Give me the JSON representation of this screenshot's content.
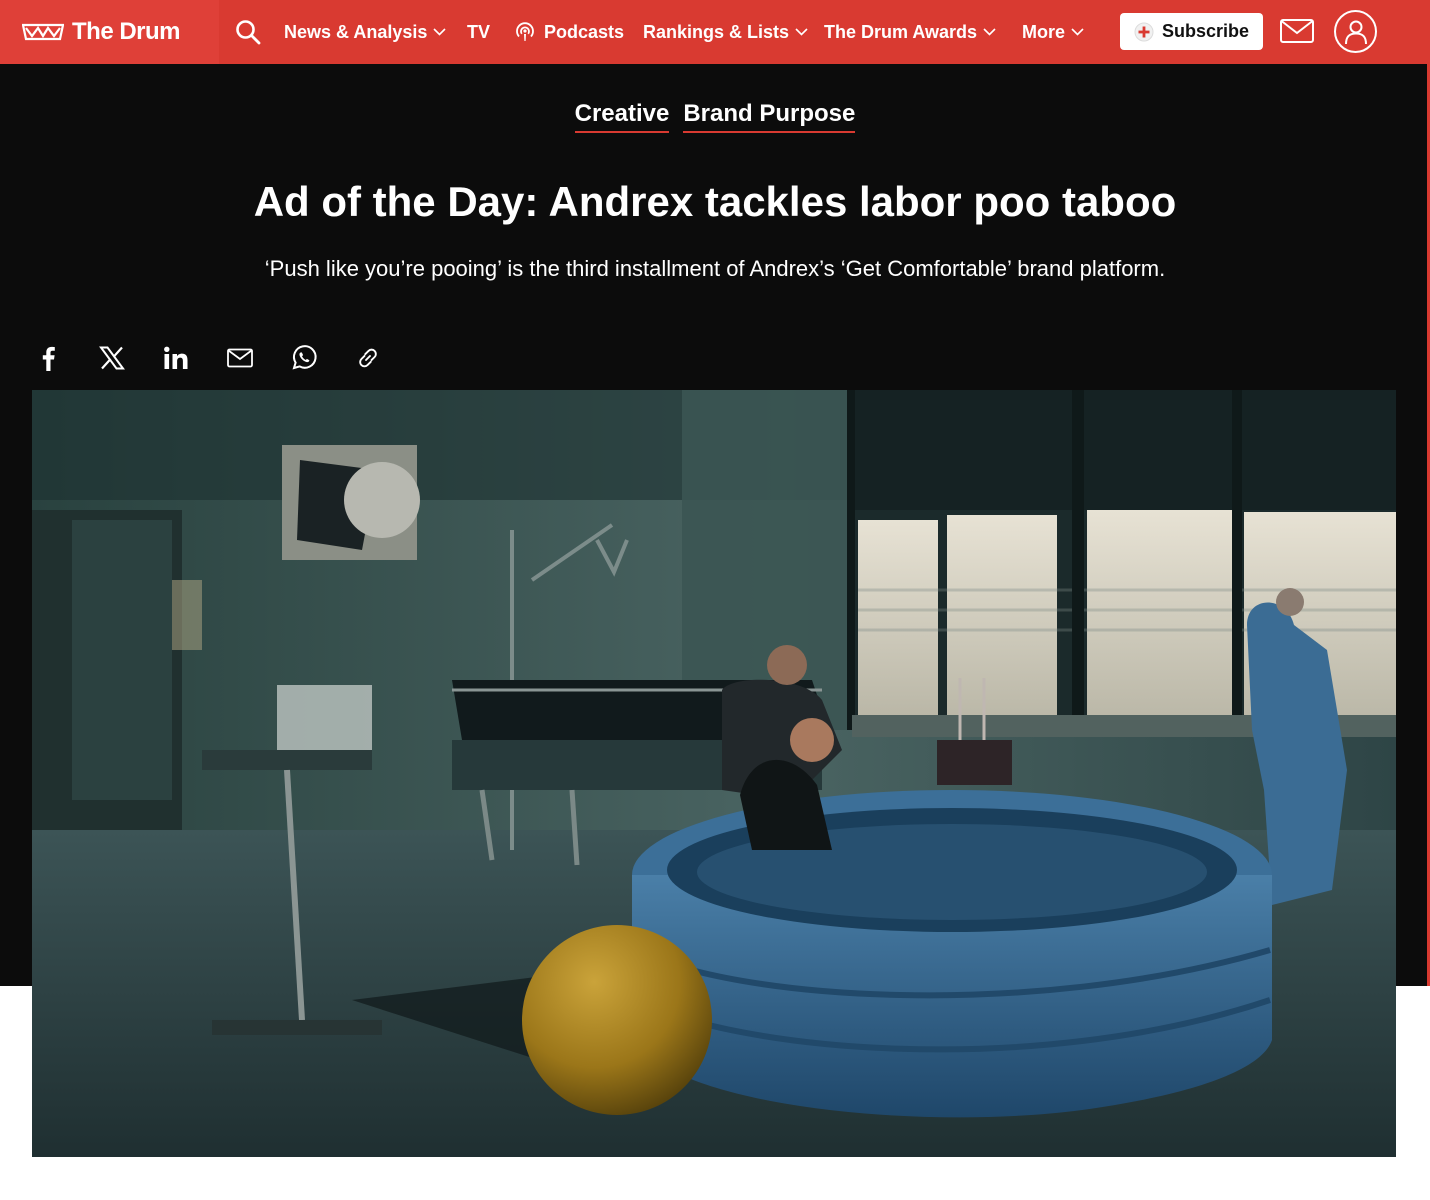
{
  "brand": {
    "name": "The Drum",
    "accent": "#d93a31",
    "dark_bg": "#0c0c0c"
  },
  "nav": {
    "search_icon": "search-icon",
    "items": [
      {
        "label": "News & Analysis",
        "has_dropdown": true
      },
      {
        "label": "TV",
        "has_dropdown": false
      },
      {
        "label": "Podcasts",
        "has_dropdown": false,
        "icon": "podcast-icon"
      },
      {
        "label": "Rankings & Lists",
        "has_dropdown": true
      },
      {
        "label": "The Drum Awards",
        "has_dropdown": true
      },
      {
        "label": "More",
        "has_dropdown": true
      }
    ],
    "subscribe_label": "Subscribe",
    "mail_icon": "mail-icon",
    "account_icon": "user-icon"
  },
  "article": {
    "tags": [
      "Creative",
      "Brand Purpose"
    ],
    "headline": "Ad of the Day: Andrex tackles labor poo taboo",
    "standfirst": "‘Push like you’re pooing’ is the third installment of Andrex’s ‘Get Comfortable’ brand platform.",
    "share_icons": [
      "facebook-icon",
      "x-icon",
      "linkedin-icon",
      "email-icon",
      "whatsapp-icon",
      "link-icon"
    ]
  }
}
